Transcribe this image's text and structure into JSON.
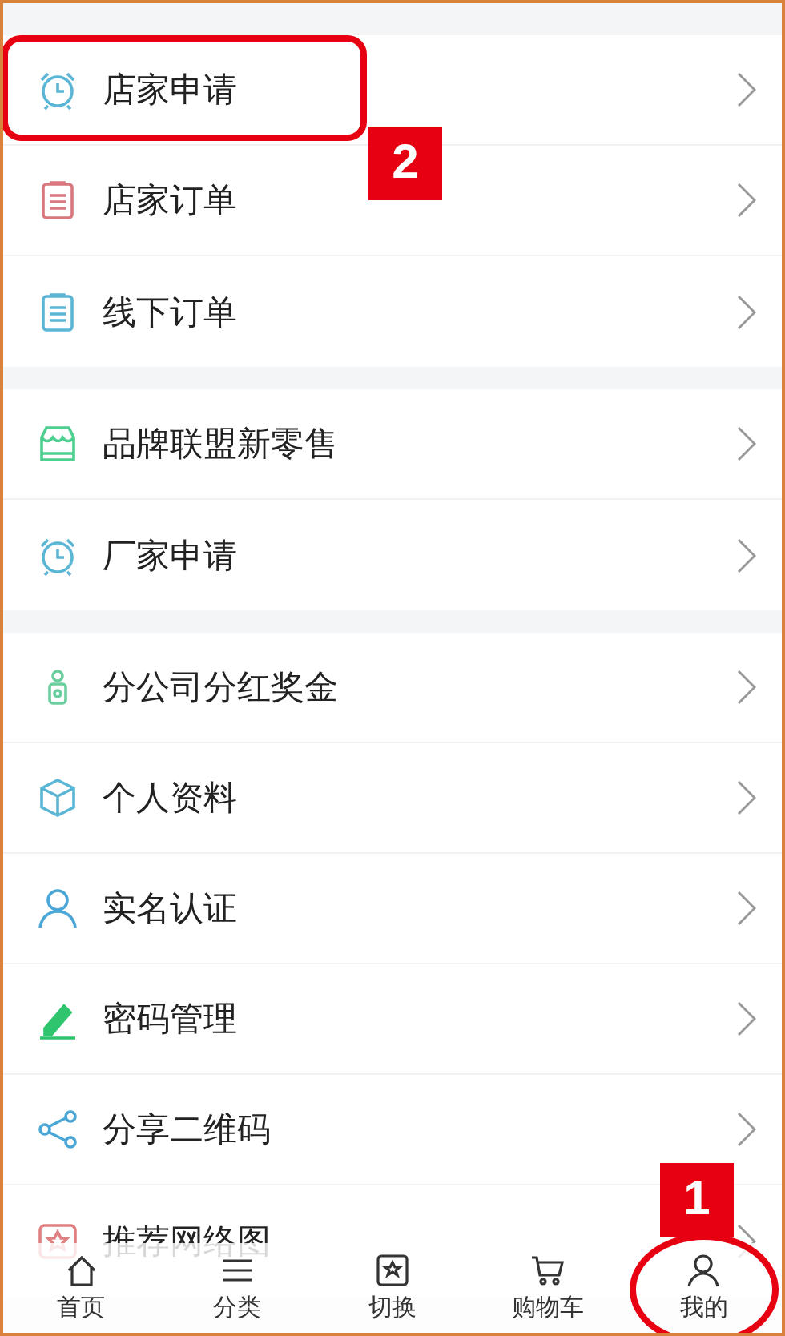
{
  "groups": [
    {
      "items": [
        {
          "label": "店家申请",
          "highlighted": true
        },
        {
          "label": "店家订单",
          "highlighted": false
        },
        {
          "label": "线下订单",
          "highlighted": false
        }
      ]
    },
    {
      "items": [
        {
          "label": "品牌联盟新零售",
          "highlighted": false
        },
        {
          "label": "厂家申请",
          "highlighted": false
        }
      ]
    },
    {
      "items": [
        {
          "label": "分公司分红奖金",
          "highlighted": false
        },
        {
          "label": "个人资料",
          "highlighted": false
        },
        {
          "label": "实名认证",
          "highlighted": false
        },
        {
          "label": "密码管理",
          "highlighted": false
        },
        {
          "label": "分享二维码",
          "highlighted": false
        },
        {
          "label": "推荐网络图",
          "highlighted": false
        }
      ]
    }
  ],
  "tab_bar": [
    {
      "label": "首页",
      "circled": false
    },
    {
      "label": "分类",
      "circled": false
    },
    {
      "label": "切换",
      "circled": false
    },
    {
      "label": "购物车",
      "circled": false
    },
    {
      "label": "我的",
      "circled": true
    }
  ],
  "step_markers": [
    {
      "label": "2"
    },
    {
      "label": "1"
    }
  ]
}
